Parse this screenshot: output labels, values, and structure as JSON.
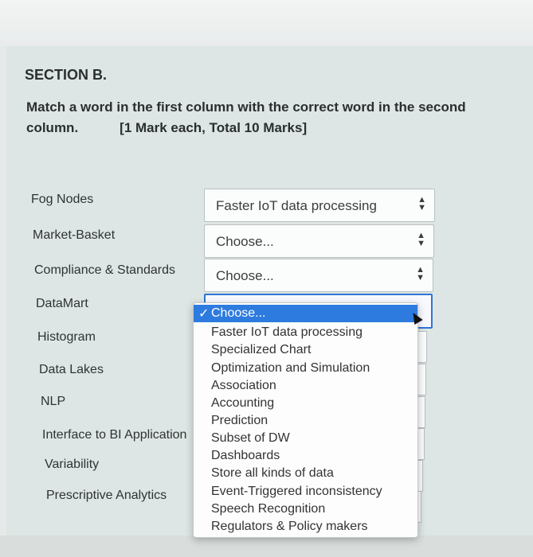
{
  "section_title": "SECTION B.",
  "instructions": {
    "line1": "Match a word in the first column with the correct word in the second",
    "line2_prefix": "column.",
    "marks": "[1 Mark each, Total 10 Marks]"
  },
  "terms": [
    "Fog Nodes",
    "Market-Basket",
    "Compliance & Standards",
    "DataMart",
    "Histogram",
    "Data Lakes",
    "NLP",
    "Interface to BI Application",
    "Variability",
    "Prescriptive Analytics"
  ],
  "selects": [
    {
      "value": "Faster IoT data processing"
    },
    {
      "value": "Choose..."
    },
    {
      "value": "Choose..."
    }
  ],
  "dropdown": {
    "selected": "Choose...",
    "check": "✓",
    "options": [
      "Faster IoT data processing",
      "Specialized Chart",
      "Optimization and Simulation",
      "Association",
      "Accounting",
      "Prediction",
      "Subset of DW",
      "Dashboards",
      "Store all kinds of data",
      "Event-Triggered inconsistency",
      "Speech Recognition",
      "Regulators & Policy makers"
    ]
  },
  "arrow_glyph": "⬍"
}
